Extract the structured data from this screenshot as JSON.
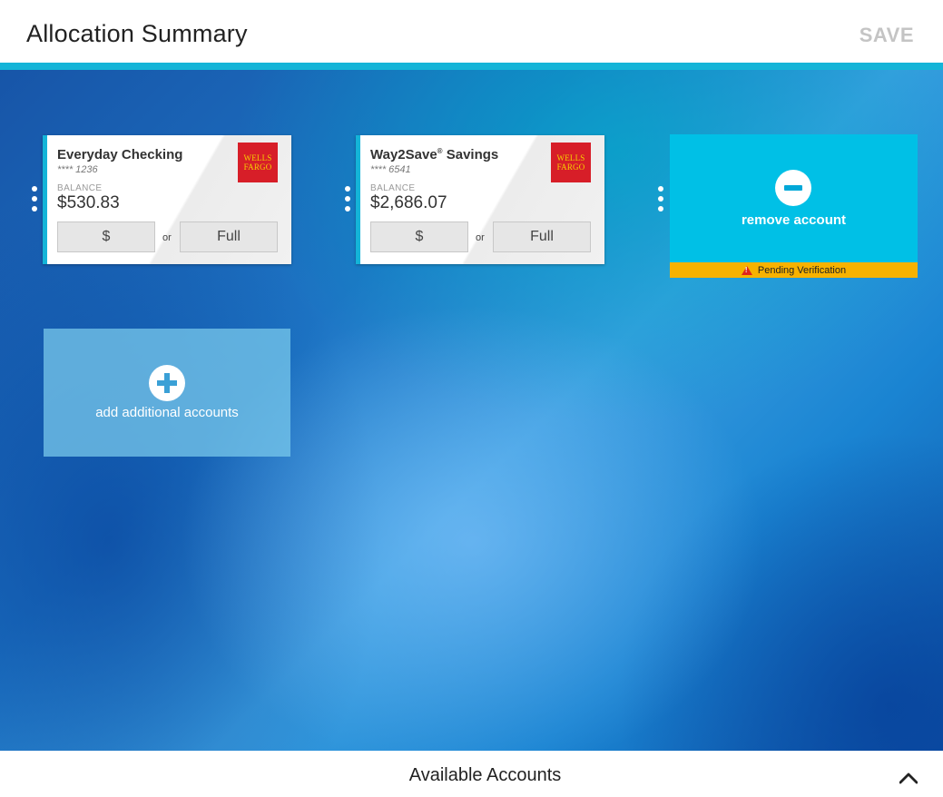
{
  "header": {
    "title": "Allocation Summary",
    "save_label": "SAVE"
  },
  "accounts": [
    {
      "name": "Everyday Checking",
      "number": "**** 1236",
      "balance_label": "BALANCE",
      "balance": "$530.83",
      "logo_line1": "WELLS",
      "logo_line2": "FARGO",
      "dollar_label": "$",
      "or_label": "or",
      "full_label": "Full"
    },
    {
      "name": "Way2Save",
      "name_mark": "®",
      "name_suffix": " Savings",
      "number": "**** 6541",
      "balance_label": "BALANCE",
      "balance": "$2,686.07",
      "logo_line1": "WELLS",
      "logo_line2": "FARGO",
      "dollar_label": "$",
      "or_label": "or",
      "full_label": "Full"
    }
  ],
  "remove_card": {
    "label": "remove account",
    "status": "Pending Verification"
  },
  "add_card": {
    "label": "add additional accounts"
  },
  "footer": {
    "title": "Available Accounts"
  },
  "colors": {
    "accent": "#14b4d8",
    "remove_bg": "#00c0e6",
    "pending": "#f7b200",
    "brand_red": "#d71e28",
    "brand_gold": "#f5d000"
  },
  "icons": [
    "drag-handle-icon",
    "minus-circle-icon",
    "plus-circle-icon",
    "warning-icon",
    "chevron-up-icon"
  ]
}
